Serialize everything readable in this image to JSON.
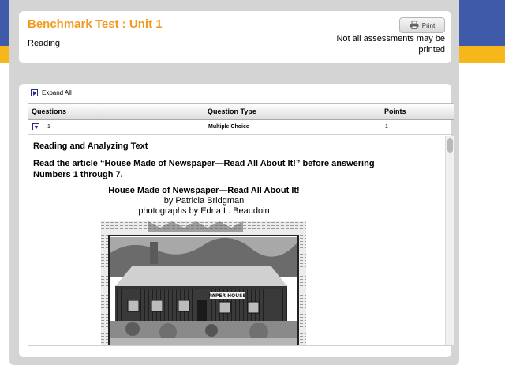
{
  "header": {
    "test_title": "Benchmark Test : Unit 1",
    "subject": "Reading",
    "print_label": "Print",
    "print_note": "Not all assessments may be printed"
  },
  "toolbar": {
    "expand_all": "Expand All"
  },
  "table": {
    "columns": [
      "Questions",
      "Question Type",
      "Points"
    ],
    "rows": [
      {
        "number": "1",
        "type": "Multiple Choice",
        "points": "1"
      }
    ]
  },
  "question": {
    "heading": "Reading and Analyzing Text",
    "instruction": "Read the article “House Made of Newspaper—Read All About It!” before answering Numbers 1 through 7.",
    "article": {
      "title": "House Made of Newspaper—Read All About It!",
      "byline": "by Patricia Bridgman",
      "photo_credit": "photographs by Edna L. Beaudoin",
      "sign_text": "PAPER HOUSE"
    }
  },
  "colors": {
    "header_blue": "#3f5aa8",
    "header_yellow": "#f6b71b",
    "title_orange": "#f39a1e",
    "page_gray": "#d4d4d4"
  },
  "icons": [
    "printer-icon",
    "expand-arrow-icon",
    "collapse-arrow-icon"
  ]
}
